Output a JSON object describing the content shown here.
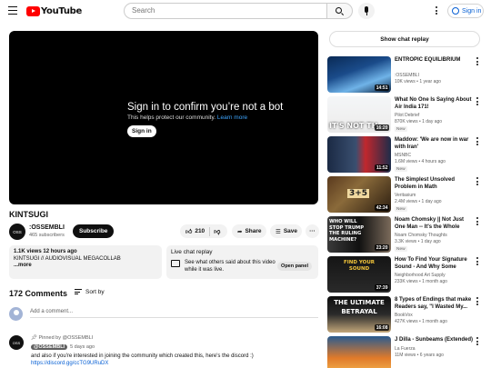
{
  "header": {
    "logo_text": "YouTube",
    "search_placeholder": "Search",
    "signin_label": "Sign in",
    "brand_color": "#ff0000",
    "link_color": "#065fd4"
  },
  "player": {
    "heading": "Sign in to confirm you’re not a bot",
    "sub_text": "This helps protect our community.",
    "learn_more": "Learn more",
    "signin_button": "Sign in"
  },
  "video": {
    "title": "KINTSUGI",
    "channel_name": ":OSSEMBLI",
    "channel_avatar_text": "OSS",
    "subscribers": "465 subscribers",
    "subscribe_label": "Subscribe",
    "likes": "210",
    "share_label": "Share",
    "save_label": "Save",
    "description": {
      "stats": "1.1K views  12 hours ago",
      "text": "KINTSUGI // AUDIOVISUAL MEGACOLLAB",
      "more": "...more"
    },
    "live_chat": {
      "title": "Live chat replay",
      "text": "See what others said about this video while it was live.",
      "open_panel": "Open panel"
    }
  },
  "comments": {
    "count": "172 Comments",
    "sort_label": "Sort by",
    "add_placeholder": "Add a comment...",
    "pinned": {
      "pinned_label": "Pinned by @OSSEMBLI",
      "author": "@OSSEMBLI",
      "time": "5 days ago",
      "text": "and also if you're interested in joining the community which created this, here's the discord :)",
      "link": "https://discord.gg/ccTG9URuDX"
    }
  },
  "sidebar": {
    "chat_replay_label": "Show chat replay",
    "recommendations": [
      {
        "title": "ENTROPIC EQUILIBRIUM",
        "channel": ":OSSEMBLI",
        "meta": "10K views • 1 year ago",
        "duration": "14:51",
        "badge": ""
      },
      {
        "title": "What No One Is Saying About Air India 171!",
        "channel": "Pilot Debrief",
        "meta": "870K views • 1 day ago",
        "duration": "16:20",
        "badge": "New",
        "thumb_text": "IT'S NOT TH"
      },
      {
        "title": "Maddow: 'We are now in war with Iran'",
        "channel": "MSNBC",
        "meta": "1.6M views • 4 hours ago",
        "duration": "11:52",
        "badge": "New"
      },
      {
        "title": "The Simplest Unsolved Problem in Math",
        "channel": "Veritasium",
        "meta": "2.4M views • 1 day ago",
        "duration": "42:34",
        "badge": "New",
        "thumb_text": "3+5"
      },
      {
        "title": "Noam Chomsky || Not Just One Man -- It's the Whole Machine",
        "channel": "Noam Chomsky Thoughts",
        "meta": "3.3K views • 1 day ago",
        "duration": "23:20",
        "badge": "New",
        "thumb_text": "WHO WILL STOP TRUMP THE RULING MACHINE?"
      },
      {
        "title": "How To Find Your Signature Sound - And Why Some Artists...",
        "channel": "Neighborhood Art Supply",
        "meta": "233K views • 1 month ago",
        "duration": "37:39",
        "badge": "",
        "thumb_text": "FIND YOUR SOUND"
      },
      {
        "title": "8 Types of Endings that make Readers say, \"I Wasted My...",
        "channel": "BookVox",
        "meta": "427K views • 1 month ago",
        "duration": "16:08",
        "badge": "",
        "thumb_text": "THE ULTIMATE BETRAYAL"
      },
      {
        "title": "J Dilla - Sunbeams (Extended)",
        "channel": "La Fuerza",
        "meta": "11M views • 6 years ago",
        "duration": "",
        "badge": ""
      }
    ]
  }
}
